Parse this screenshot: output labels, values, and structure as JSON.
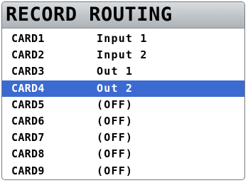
{
  "header": {
    "title": "RECORD ROUTING"
  },
  "routing": {
    "selected_index": 3,
    "rows": [
      {
        "card": "CARD1",
        "route": "Input 1"
      },
      {
        "card": "CARD2",
        "route": "Input 2"
      },
      {
        "card": "CARD3",
        "route": "Out 1"
      },
      {
        "card": "CARD4",
        "route": "Out 2"
      },
      {
        "card": "CARD5",
        "route": "(OFF)"
      },
      {
        "card": "CARD6",
        "route": "(OFF)"
      },
      {
        "card": "CARD7",
        "route": "(OFF)"
      },
      {
        "card": "CARD8",
        "route": "(OFF)"
      },
      {
        "card": "CARD9",
        "route": "(OFF)"
      }
    ]
  },
  "colors": {
    "selection": "#3b6ad0",
    "title_bar": "#bfc4c8",
    "text": "#000000",
    "selected_text": "#ffffff"
  }
}
